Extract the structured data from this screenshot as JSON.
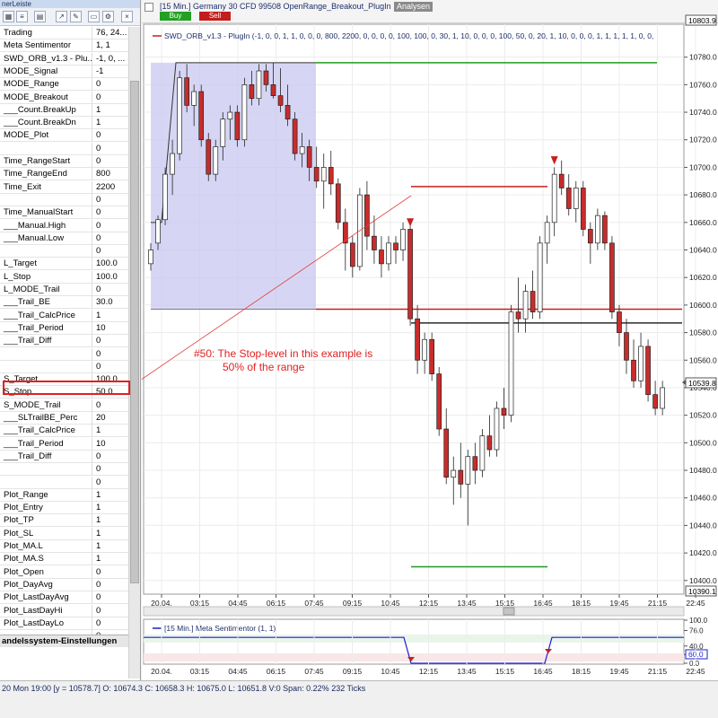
{
  "left_panel": {
    "title": "nerLeiste",
    "section_header": "andelssystem-Einstellungen",
    "properties": [
      {
        "name": "Trading",
        "value": "76, 24..."
      },
      {
        "name": "Meta Sentimentor",
        "value": "1, 1"
      },
      {
        "name": "SWD_ORB_v1.3 - Plu...",
        "value": "-1, 0, ..."
      },
      {
        "name": "MODE_Signal",
        "value": "-1"
      },
      {
        "name": "MODE_Range",
        "value": "0"
      },
      {
        "name": "MODE_Breakout",
        "value": "0"
      },
      {
        "name": "___Count.BreakUp",
        "value": "1"
      },
      {
        "name": "___Count.BreakDn",
        "value": "1"
      },
      {
        "name": "MODE_Plot",
        "value": "0"
      },
      {
        "name": "",
        "value": "0"
      },
      {
        "name": "Time_RangeStart",
        "value": "0"
      },
      {
        "name": "Time_RangeEnd",
        "value": "800"
      },
      {
        "name": "Time_Exit",
        "value": "2200"
      },
      {
        "name": "",
        "value": "0"
      },
      {
        "name": "Time_ManualStart",
        "value": "0"
      },
      {
        "name": "___Manual.High",
        "value": "0"
      },
      {
        "name": "___Manual.Low",
        "value": "0"
      },
      {
        "name": "",
        "value": "0"
      },
      {
        "name": "L_Target",
        "value": "100.0"
      },
      {
        "name": "L_Stop",
        "value": "100.0"
      },
      {
        "name": "L_MODE_Trail",
        "value": "0"
      },
      {
        "name": "___Trail_BE",
        "value": "30.0"
      },
      {
        "name": "___Trail_CalcPrice",
        "value": "1"
      },
      {
        "name": "___Trail_Period",
        "value": "10"
      },
      {
        "name": "___Trail_Diff",
        "value": "0"
      },
      {
        "name": "",
        "value": "0"
      },
      {
        "name": "",
        "value": "0"
      },
      {
        "name": "S_Target",
        "value": "100.0"
      },
      {
        "name": "S_Stop",
        "value": "50.0"
      },
      {
        "name": "S_MODE_Trail",
        "value": "0"
      },
      {
        "name": "___SLTrailBE_Perc",
        "value": "20"
      },
      {
        "name": "___Trail_CalcPrice",
        "value": "1"
      },
      {
        "name": "___Trail_Period",
        "value": "10"
      },
      {
        "name": "___Trail_Diff",
        "value": "0"
      },
      {
        "name": "",
        "value": "0"
      },
      {
        "name": "",
        "value": "0"
      },
      {
        "name": "Plot_Range",
        "value": "1"
      },
      {
        "name": "Plot_Entry",
        "value": "1"
      },
      {
        "name": "Plot_TP",
        "value": "1"
      },
      {
        "name": "Plot_SL",
        "value": "1"
      },
      {
        "name": "Plot_MA.L",
        "value": "1"
      },
      {
        "name": "Plot_MA.S",
        "value": "1"
      },
      {
        "name": "Plot_Open",
        "value": "0"
      },
      {
        "name": "Plot_DayAvg",
        "value": "0"
      },
      {
        "name": "Plot_LastDayAvg",
        "value": "0"
      },
      {
        "name": "Plot_LastDayHi",
        "value": "0"
      },
      {
        "name": "Plot_LastDayLo",
        "value": "0"
      },
      {
        "name": "",
        "value": "0"
      }
    ]
  },
  "chart": {
    "title": "[15 Min.] Germany 30 CFD   99508 OpenRange_Breakout_PlugIn",
    "analysen_label": "Analysen",
    "buy_label": "Buy",
    "sell_label": "Sell",
    "indicator_label": "SWD_ORB_v1.3 - PlugIn  (-1, 0, 0, 1, 1, 0, 0, 0, 800, 2200, 0, 0, 0, 0, 100, 100, 0, 30, 1, 10, 0, 0, 0, 100, 50, 0, 20, 1, 10, 0, 0, 0, 1, 1, 1, 1, 1, 0, 0,",
    "price_top_label": "10803.9",
    "price_bottom_label": "10390.1",
    "last_price_label": "10539.8",
    "y_ticks": [
      "10780.0",
      "10760.0",
      "10740.0",
      "10720.0",
      "10700.0",
      "10680.0",
      "10660.0",
      "10640.0",
      "10620.0",
      "10600.0",
      "10580.0",
      "10560.0",
      "10540.0",
      "10520.0",
      "10500.0",
      "10480.0",
      "10460.0",
      "10440.0",
      "10420.0",
      "10400.0"
    ],
    "x_ticks": [
      "20.04.",
      "03:15",
      "04:45",
      "06:15",
      "07:45",
      "09:15",
      "10:45",
      "12:15",
      "13:45",
      "15:15",
      "16:45",
      "18:15",
      "19:45",
      "21:15",
      "22:45"
    ],
    "annotation_line1": "#50: The Stop-level in this example is",
    "annotation_line2": "50% of the range",
    "colors": {
      "range_box": "#c8c8f0",
      "target": "#1f9a1f",
      "stop": "#c81e1e",
      "entry": "#000000",
      "sentiment_line": "#1c1cd0"
    }
  },
  "sentiment": {
    "label": "[15 Min.] Meta Sentimentor  (1, 1)",
    "y_ticks": [
      "100.0",
      "76.0",
      "40.0",
      "20.0",
      "0.0"
    ],
    "current_value": "60.0",
    "x_ticks": [
      "20.04.",
      "03:15",
      "04:45",
      "06:15",
      "07:45",
      "09:15",
      "10:45",
      "12:15",
      "13:45",
      "15:15",
      "16:45",
      "18:15",
      "19:45",
      "21:15",
      "22:45"
    ]
  },
  "status_bar": {
    "text": "20 Mon  19:00 [y = 10578.7]      O: 10674.3 C: 10658.3 H: 10675.0 L: 10651.8 V:0 Span: 0.22% 232 Ticks"
  },
  "chart_data": {
    "type": "candlestick",
    "title": "[15 Min.] Germany 30 CFD   99508 OpenRange_Breakout_PlugIn",
    "ylim": [
      10390.1,
      10803.9
    ],
    "candles": [
      [
        10630,
        10645,
        10625,
        10640
      ],
      [
        10645,
        10665,
        10640,
        10662
      ],
      [
        10662,
        10700,
        10658,
        10695
      ],
      [
        10695,
        10720,
        10680,
        10710
      ],
      [
        10710,
        10770,
        10705,
        10765
      ],
      [
        10765,
        10775,
        10740,
        10745
      ],
      [
        10745,
        10760,
        10730,
        10755
      ],
      [
        10755,
        10760,
        10715,
        10720
      ],
      [
        10720,
        10725,
        10690,
        10695
      ],
      [
        10695,
        10720,
        10690,
        10715
      ],
      [
        10715,
        10740,
        10705,
        10735
      ],
      [
        10735,
        10745,
        10720,
        10740
      ],
      [
        10740,
        10745,
        10715,
        10720
      ],
      [
        10720,
        10765,
        10715,
        10760
      ],
      [
        10760,
        10770,
        10745,
        10750
      ],
      [
        10750,
        10775,
        10745,
        10770
      ],
      [
        10770,
        10775,
        10755,
        10760
      ],
      [
        10760,
        10776,
        10750,
        10752
      ],
      [
        10752,
        10772,
        10740,
        10745
      ],
      [
        10745,
        10760,
        10730,
        10735
      ],
      [
        10735,
        10740,
        10705,
        10710
      ],
      [
        10710,
        10725,
        10700,
        10715
      ],
      [
        10715,
        10720,
        10690,
        10700
      ],
      [
        10700,
        10715,
        10685,
        10690
      ],
      [
        10690,
        10710,
        10670,
        10700
      ],
      [
        10700,
        10712,
        10680,
        10688
      ],
      [
        10688,
        10692,
        10655,
        10660
      ],
      [
        10660,
        10670,
        10625,
        10645
      ],
      [
        10645,
        10650,
        10620,
        10628
      ],
      [
        10628,
        10685,
        10625,
        10680
      ],
      [
        10680,
        10690,
        10640,
        10650
      ],
      [
        10650,
        10665,
        10630,
        10640
      ],
      [
        10640,
        10650,
        10620,
        10630
      ],
      [
        10630,
        10650,
        10625,
        10645
      ],
      [
        10645,
        10650,
        10630,
        10640
      ],
      [
        10640,
        10660,
        10632,
        10655
      ],
      [
        10655,
        10660,
        10585,
        10590
      ],
      [
        10590,
        10600,
        10550,
        10560
      ],
      [
        10560,
        10580,
        10550,
        10575
      ],
      [
        10575,
        10580,
        10545,
        10550
      ],
      [
        10550,
        10555,
        10505,
        10510
      ],
      [
        10510,
        10525,
        10470,
        10475
      ],
      [
        10475,
        10490,
        10455,
        10480
      ],
      [
        10480,
        10500,
        10460,
        10470
      ],
      [
        10470,
        10495,
        10440,
        10490
      ],
      [
        10490,
        10500,
        10470,
        10480
      ],
      [
        10480,
        10510,
        10475,
        10505
      ],
      [
        10505,
        10520,
        10490,
        10495
      ],
      [
        10495,
        10530,
        10490,
        10525
      ],
      [
        10525,
        10540,
        10510,
        10520
      ],
      [
        10520,
        10600,
        10515,
        10595
      ],
      [
        10595,
        10620,
        10580,
        10590
      ],
      [
        10590,
        10615,
        10580,
        10610
      ],
      [
        10610,
        10625,
        10590,
        10595
      ],
      [
        10595,
        10650,
        10590,
        10645
      ],
      [
        10645,
        10665,
        10630,
        10660
      ],
      [
        10660,
        10700,
        10650,
        10695
      ],
      [
        10695,
        10705,
        10680,
        10685
      ],
      [
        10685,
        10695,
        10665,
        10670
      ],
      [
        10670,
        10690,
        10660,
        10685
      ],
      [
        10685,
        10690,
        10650,
        10655
      ],
      [
        10655,
        10660,
        10630,
        10645
      ],
      [
        10645,
        10670,
        10640,
        10665
      ],
      [
        10665,
        10668,
        10640,
        10645
      ],
      [
        10645,
        10650,
        10590,
        10595
      ],
      [
        10595,
        10600,
        10570,
        10580
      ],
      [
        10580,
        10590,
        10550,
        10560
      ],
      [
        10560,
        10575,
        10540,
        10545
      ],
      [
        10545,
        10580,
        10540,
        10570
      ],
      [
        10570,
        10575,
        10530,
        10535
      ],
      [
        10535,
        10545,
        10520,
        10525
      ],
      [
        10525,
        10545,
        10520,
        10540
      ]
    ],
    "opening_range": {
      "high": 10776,
      "low": 10597
    },
    "levels": {
      "long_target": 10776,
      "short_target": 10410,
      "long_entry_stop": 10686,
      "short_stop": 10597,
      "entry_line": 10587
    }
  }
}
